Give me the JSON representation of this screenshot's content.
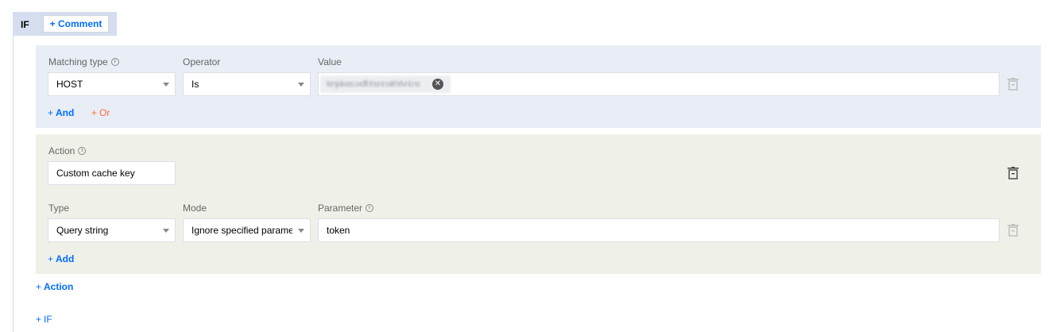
{
  "if_block": {
    "label": "IF",
    "comment_button": "+ Comment"
  },
  "condition": {
    "matching_type_label": "Matching type",
    "operator_label": "Operator",
    "value_label": "Value",
    "matching_type_value": "HOST",
    "operator_value": "Is",
    "value_tag": "lenjalvas.wdfnhsnr.wlrhrlvnl.ns",
    "and_link": "And",
    "or_link": "Or"
  },
  "action": {
    "action_label": "Action",
    "action_value": "Custom cache key",
    "type_label": "Type",
    "mode_label": "Mode",
    "parameter_label": "Parameter",
    "type_value": "Query string",
    "mode_value": "Ignore specified parameters",
    "parameter_value": "token",
    "add_link": "Add"
  },
  "footer": {
    "action_link": "Action",
    "if_link": "IF"
  },
  "icons": {
    "info": "info-circle-icon",
    "trash": "trash-icon",
    "caret": "caret-down-icon",
    "close": "close-circle-icon"
  },
  "colors": {
    "accent_blue": "#006eff",
    "or_orange": "#ff6a3d",
    "condition_bg": "#e9edf5",
    "action_bg": "#eff1e9",
    "if_bg": "#d5deef"
  }
}
